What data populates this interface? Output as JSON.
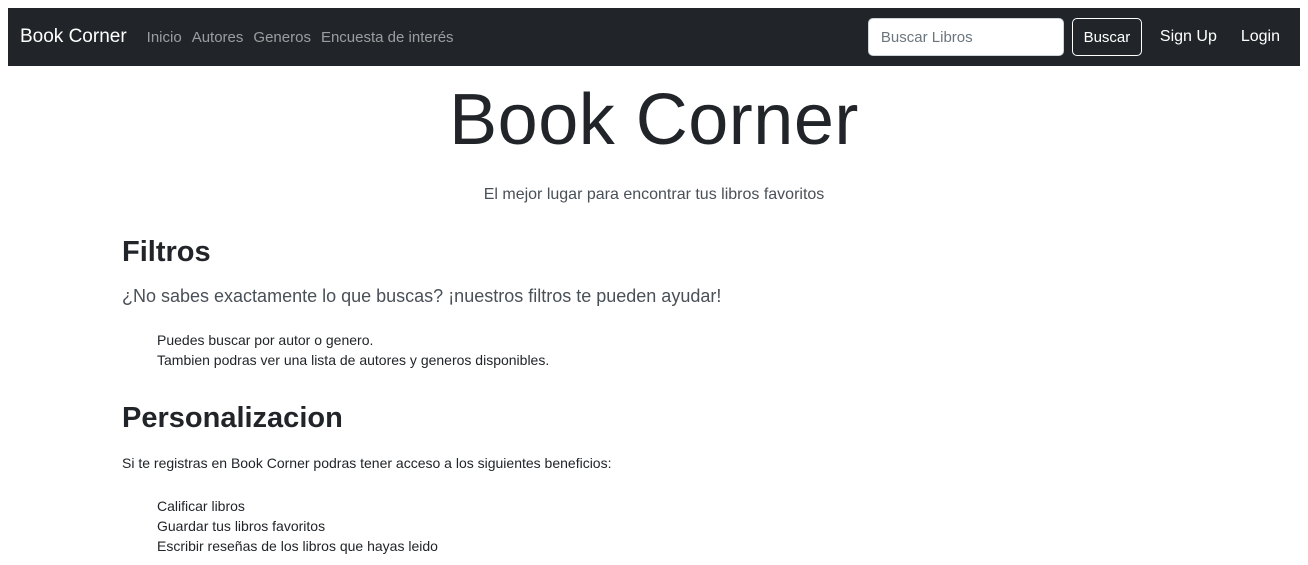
{
  "navbar": {
    "brand": "Book Corner",
    "links": [
      "Inicio",
      "Autores",
      "Generos",
      "Encuesta de interés"
    ],
    "search": {
      "placeholder": "Buscar Libros",
      "value": ""
    },
    "search_button": "Buscar",
    "signup": "Sign Up",
    "login": "Login",
    "background": "#212529"
  },
  "hero": {
    "title": "Book Corner",
    "subtitle": "El mejor lugar para encontrar tus libros favoritos"
  },
  "filters": {
    "heading": "Filtros",
    "lead": "¿No sabes exactamente lo que buscas? ¡nuestros filtros te pueden ayudar!",
    "items": [
      "Puedes buscar por autor o genero.",
      "Tambien podras ver una lista de autores y generos disponibles."
    ]
  },
  "personalization": {
    "heading": "Personalizacion",
    "text": "Si te registras en Book Corner podras tener acceso a los siguientes beneficios:",
    "items": [
      "Calificar libros",
      "Guardar tus libros favoritos",
      "Escribir reseñas de los libros que hayas leido"
    ]
  }
}
